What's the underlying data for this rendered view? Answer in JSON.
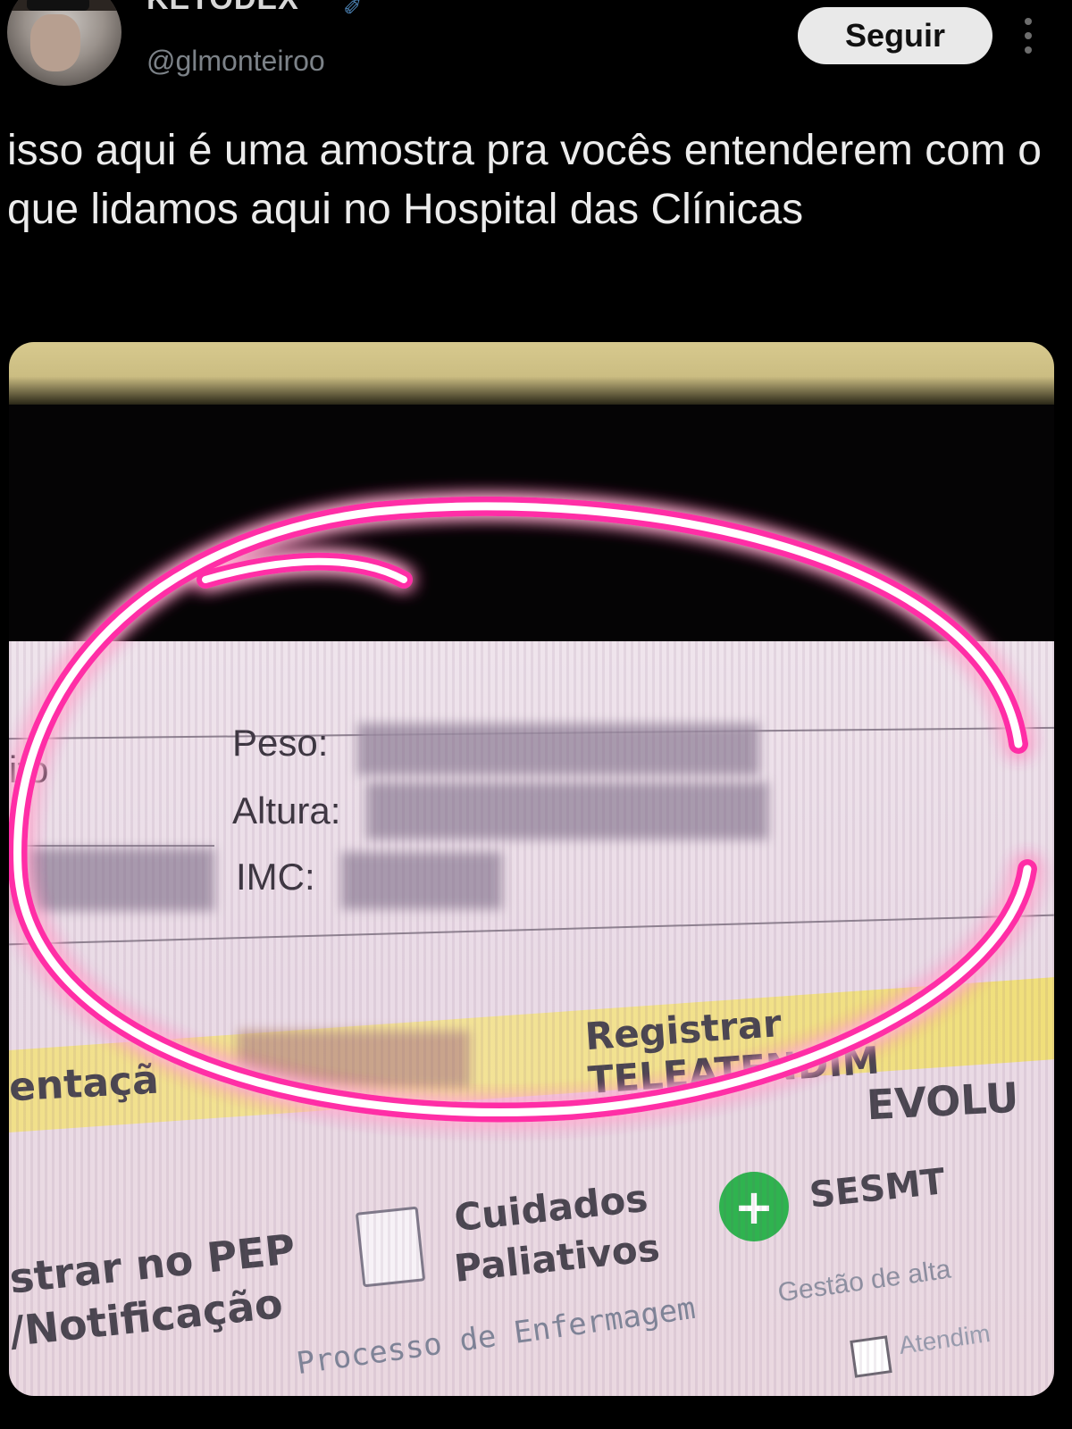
{
  "tweet": {
    "display_name": "KETODEX",
    "handle": "@glmonteiroo",
    "follow_label": "Seguir",
    "text": "isso aqui é uma amostra pra vocês entenderem com o que lidamos aqui no Hospital das Clínicas"
  },
  "photo": {
    "left_fragment": "ito",
    "fields": {
      "peso_label": "Peso:",
      "altura_label": "Altura:",
      "imc_label": "IMC:"
    },
    "register_label": "Registrar TELEATENDIM",
    "orientation_fragment": "entaçã",
    "evolution_fragment": "EVOLU",
    "pep_line1": "strar no PEP",
    "pep_line2": "/Notificação",
    "cuidados_line1": "Cuidados",
    "cuidados_line2": "Paliativos",
    "sesmt_label": "SESMT",
    "processo_label": "Processo de Enfermagem",
    "gestao_label": "Gestão de alta",
    "atend_label": "Atendim"
  },
  "colors": {
    "annotation": "#ff2fa6",
    "sesmt_green": "#2fb34f"
  }
}
